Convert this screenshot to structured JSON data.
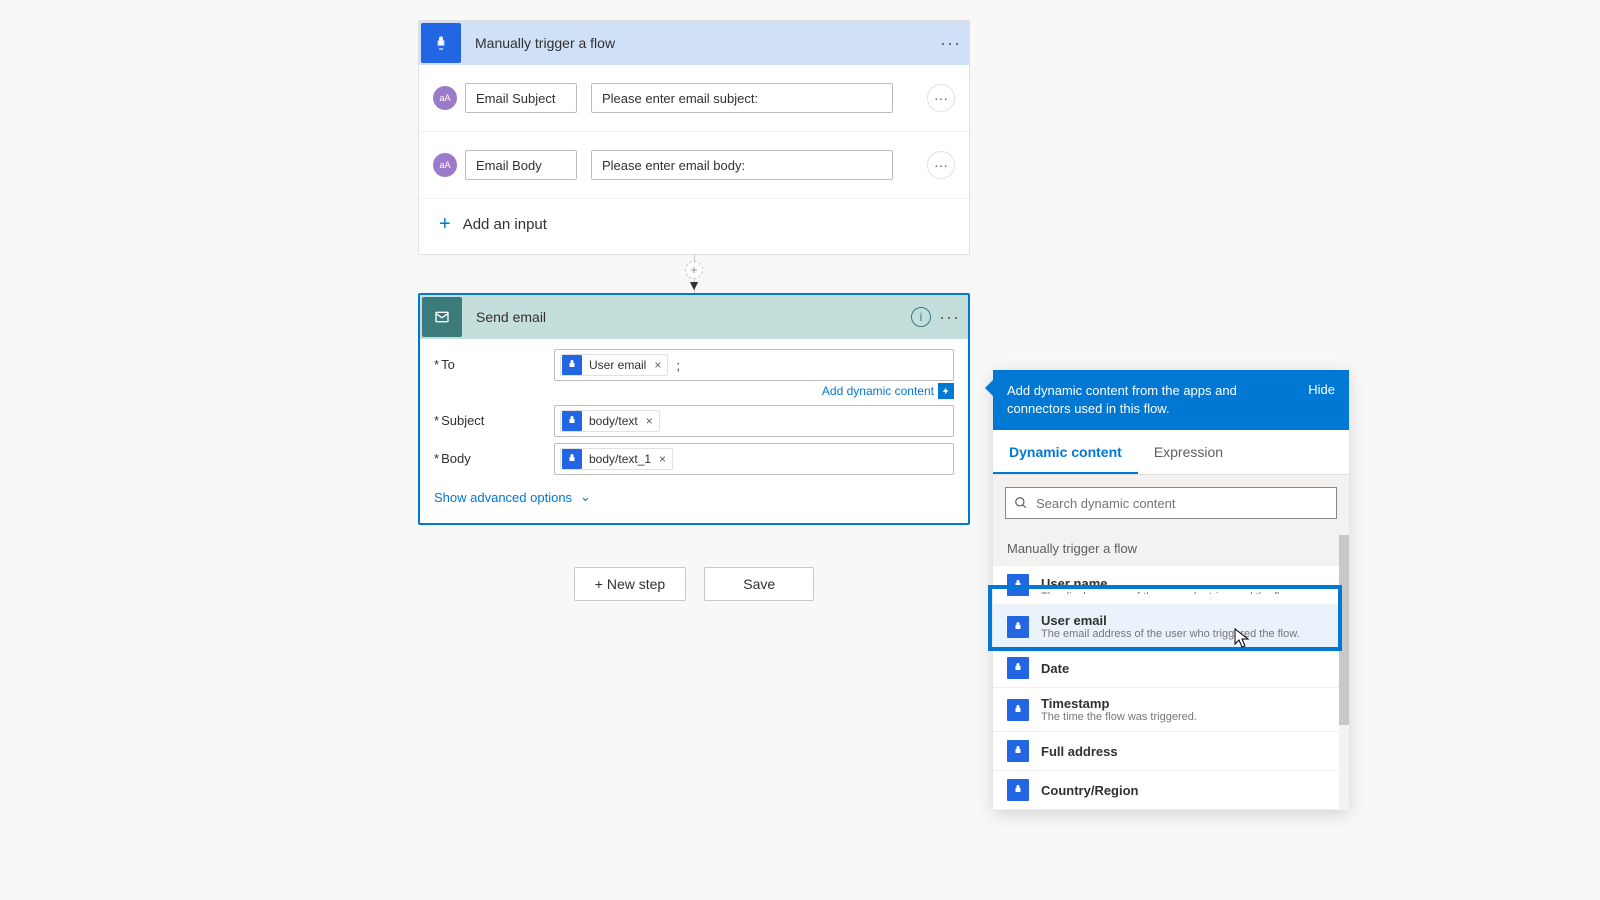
{
  "trigger": {
    "title": "Manually trigger a flow",
    "inputs": [
      {
        "label": "Email Subject",
        "placeholder": "Please enter email subject:",
        "badge": "aA"
      },
      {
        "label": "Email Body",
        "placeholder": "Please enter email body:",
        "badge": "aA"
      }
    ],
    "add_input": "Add an input"
  },
  "email": {
    "title": "Send email",
    "fields": {
      "to": {
        "label": "To",
        "token": "User email",
        "suffix": ";"
      },
      "subject": {
        "label": "Subject",
        "token": "body/text"
      },
      "body": {
        "label": "Body",
        "token": "body/text_1"
      }
    },
    "add_dynamic": "Add dynamic content",
    "show_advanced": "Show advanced options"
  },
  "buttons": {
    "new_step": "+ New step",
    "save": "Save"
  },
  "dyn": {
    "header": "Add dynamic content from the apps and connectors used in this flow.",
    "hide": "Hide",
    "tab1": "Dynamic content",
    "tab2": "Expression",
    "search": "Search dynamic content",
    "section": "Manually trigger a flow",
    "items": [
      {
        "title": "User name",
        "desc": "The display name of the user who triggered the flow"
      },
      {
        "title": "User email",
        "desc": "The email address of the user who triggered the flow."
      },
      {
        "title": "Date",
        "desc": ""
      },
      {
        "title": "Timestamp",
        "desc": "The time the flow was triggered."
      },
      {
        "title": "Full address",
        "desc": ""
      },
      {
        "title": "Country/Region",
        "desc": ""
      }
    ]
  }
}
